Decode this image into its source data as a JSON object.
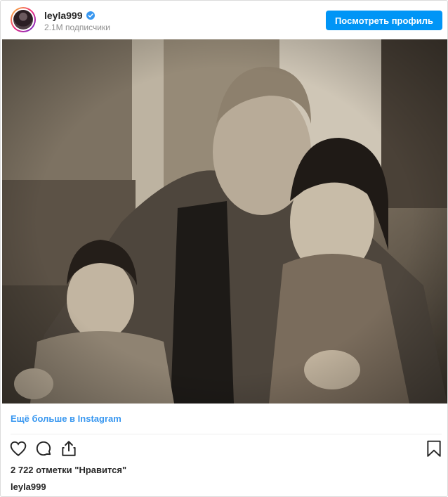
{
  "header": {
    "username": "leyla999",
    "followers": "2.1M подписчики",
    "view_profile": "Посмотреть профиль"
  },
  "post": {
    "photo_description": "",
    "more_link": "Ещё больше в Instagram",
    "likes": "2 722 отметки \"Нравится\"",
    "caption_username": "leyla999"
  },
  "icons": {
    "verified": "verified-badge-icon",
    "like": "heart-icon",
    "comment": "comment-icon",
    "share": "share-icon",
    "save": "bookmark-icon"
  },
  "colors": {
    "accent": "#0095f6",
    "link": "#3897f0",
    "verified": "#3897f0"
  }
}
